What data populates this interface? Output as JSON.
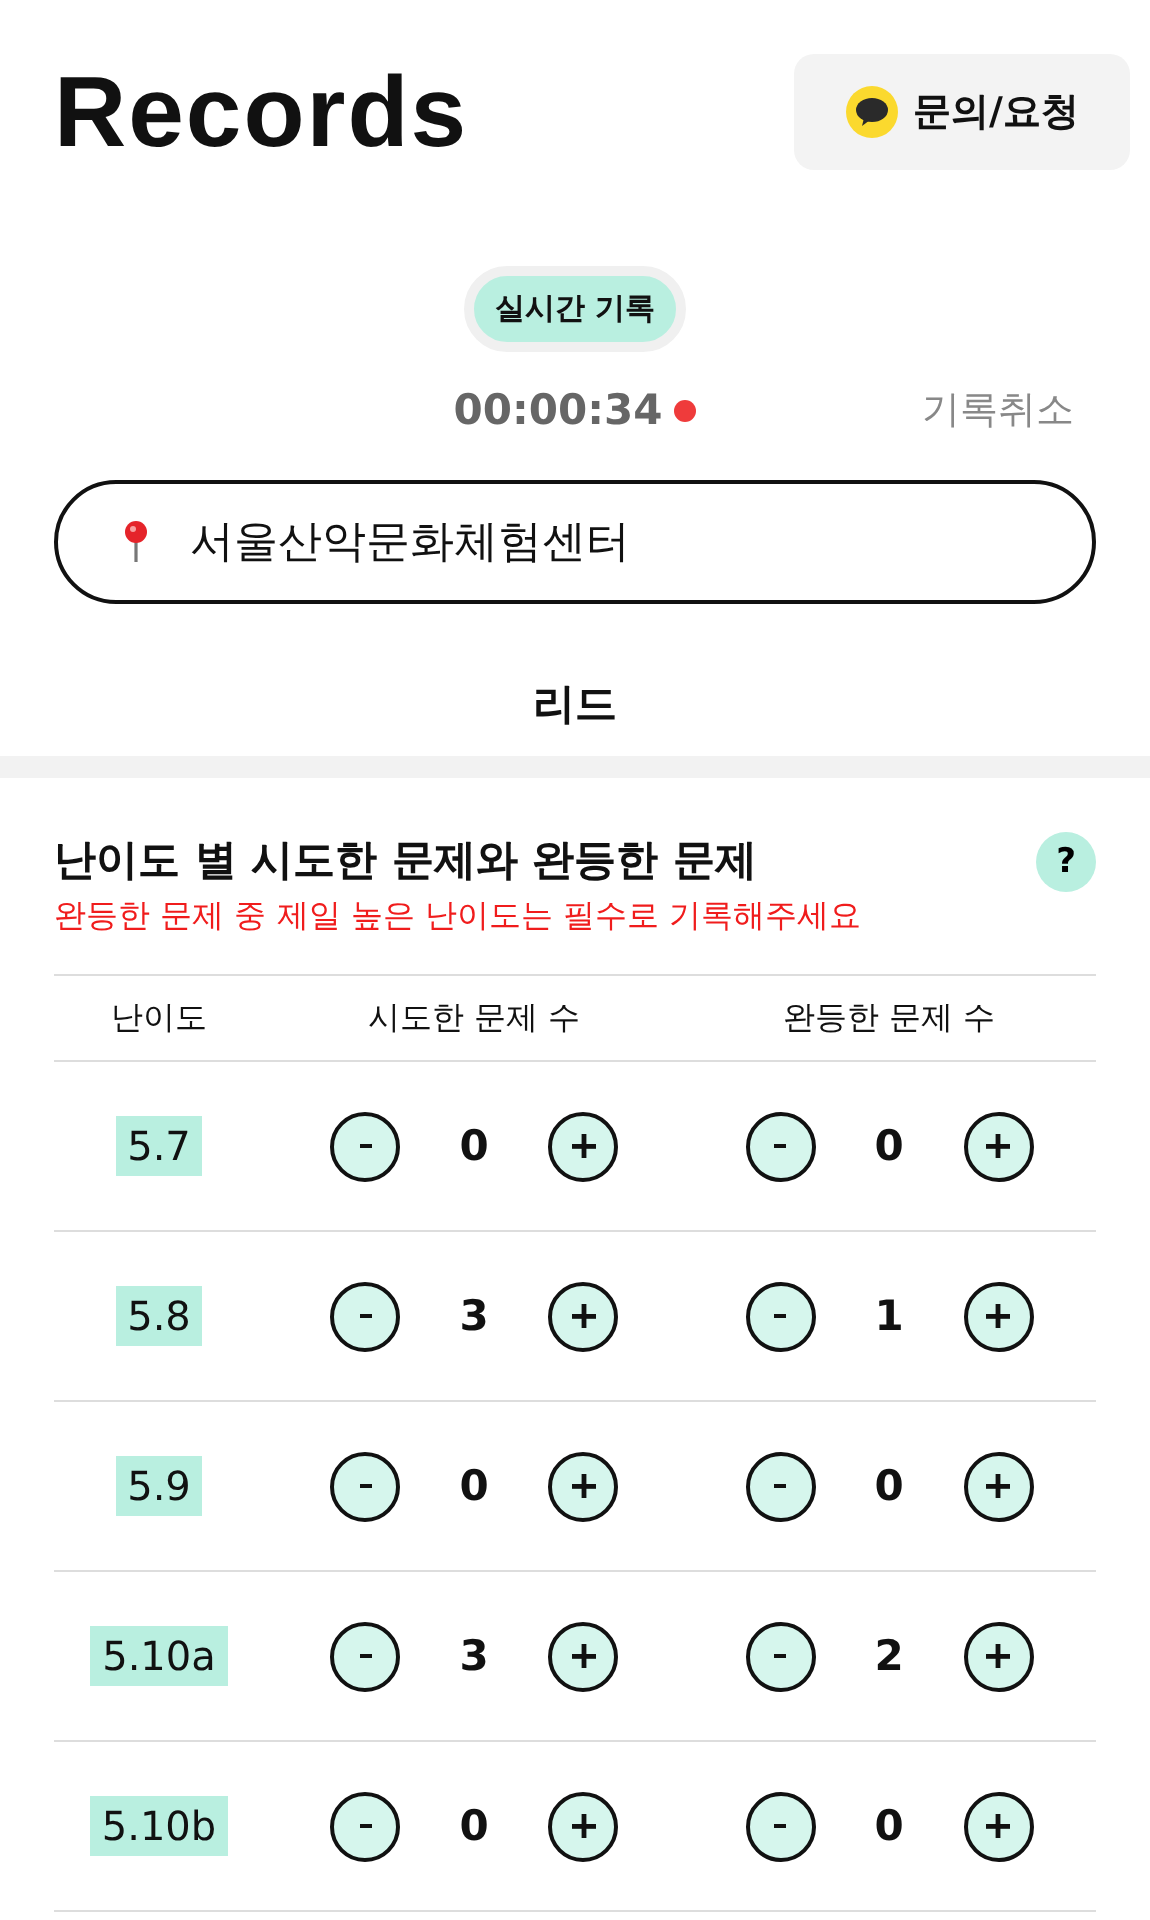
{
  "header": {
    "title": "Records",
    "inquiry_button": "문의/요청"
  },
  "mode_pill": "실시간 기록",
  "timer": {
    "time": "00:00:34",
    "recording": true,
    "cancel": "기록취소"
  },
  "location": {
    "value": "서울산악문화체험센터"
  },
  "discipline": "리드",
  "section": {
    "title": "난이도 별 시도한 문제와 완등한 문제",
    "help": "?",
    "notice": "완등한 문제 중 제일 높은 난이도는 필수로 기록해주세요"
  },
  "table": {
    "columns": [
      "난이도",
      "시도한 문제 수",
      "완등한 문제 수"
    ],
    "rows": [
      {
        "grade": "5.7",
        "attempted": "0",
        "sent": "0"
      },
      {
        "grade": "5.8",
        "attempted": "3",
        "sent": "1"
      },
      {
        "grade": "5.9",
        "attempted": "0",
        "sent": "0"
      },
      {
        "grade": "5.10a",
        "attempted": "3",
        "sent": "2"
      },
      {
        "grade": "5.10b",
        "attempted": "0",
        "sent": "0"
      }
    ]
  }
}
